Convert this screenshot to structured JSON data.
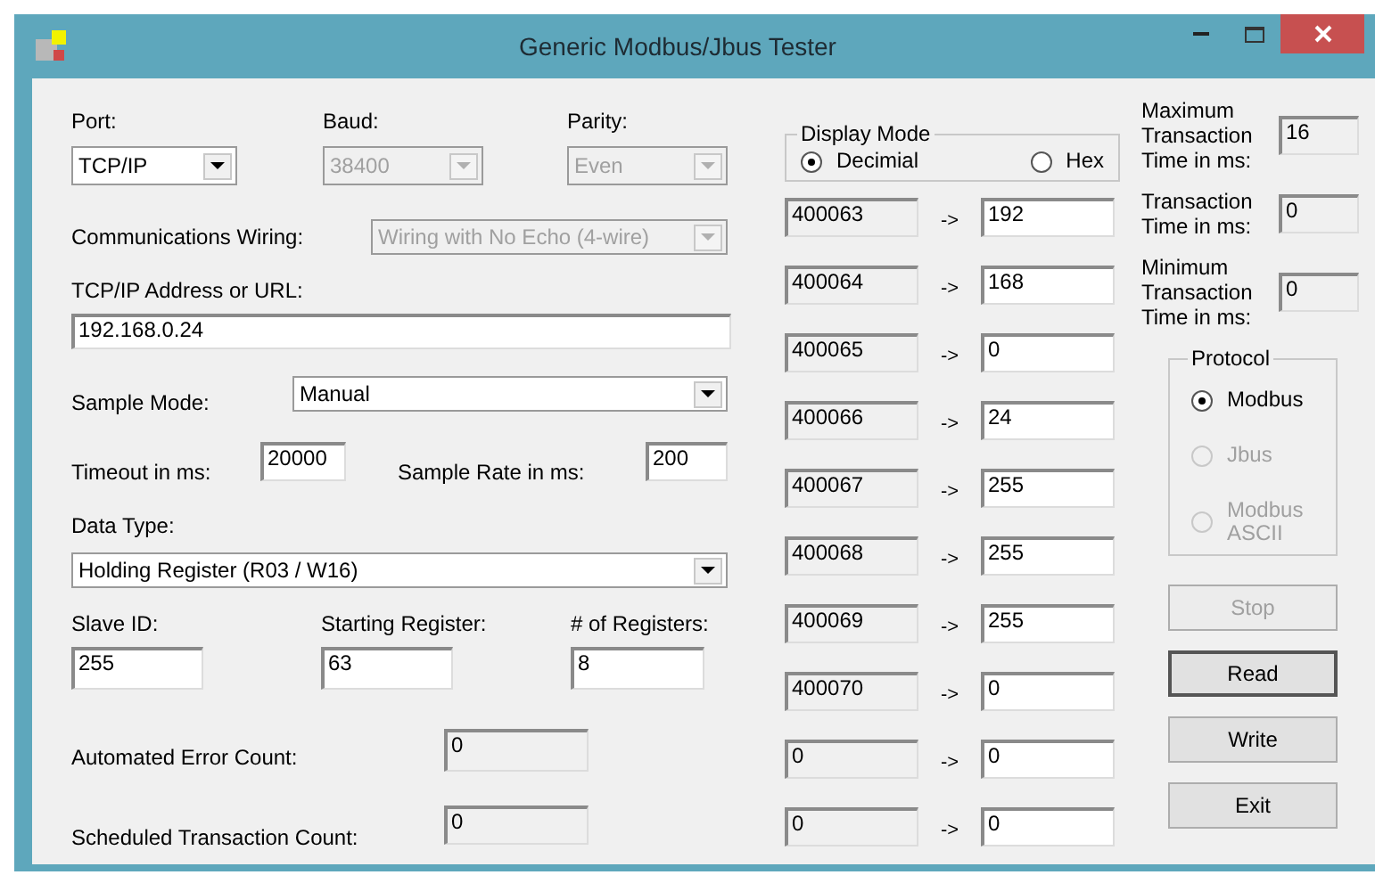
{
  "window": {
    "title": "Generic Modbus/Jbus Tester"
  },
  "port": {
    "label": "Port:",
    "value": "TCP/IP",
    "disabled": false
  },
  "baud": {
    "label": "Baud:",
    "value": "38400",
    "disabled": true
  },
  "parity": {
    "label": "Parity:",
    "value": "Even",
    "disabled": true
  },
  "wiring": {
    "label": "Communications Wiring:",
    "value": "Wiring with No Echo (4-wire)",
    "disabled": true
  },
  "address": {
    "label": "TCP/IP Address or URL:",
    "value": "192.168.0.24"
  },
  "sample_mode": {
    "label": "Sample Mode:",
    "value": "Manual",
    "disabled": false
  },
  "timeout": {
    "label": "Timeout in ms:",
    "value": "20000"
  },
  "sample_rate": {
    "label": "Sample Rate in ms:",
    "value": "200"
  },
  "data_type": {
    "label": "Data Type:",
    "value": "Holding Register (R03 / W16)",
    "disabled": false
  },
  "slave_id": {
    "label": "Slave ID:",
    "value": "255"
  },
  "starting_register": {
    "label": "Starting Register:",
    "value": "63"
  },
  "register_count": {
    "label": "# of Registers:",
    "value": "8"
  },
  "error_count": {
    "label": "Automated Error Count:",
    "value": "0"
  },
  "transaction_count": {
    "label": "Scheduled Transaction Count:",
    "value": "0"
  },
  "display_mode": {
    "label": "Display Mode",
    "options": [
      {
        "label": "Decimial",
        "selected": true
      },
      {
        "label": "Hex",
        "selected": false
      }
    ]
  },
  "registers": [
    {
      "address": "400063",
      "arrow": "->",
      "value": "192"
    },
    {
      "address": "400064",
      "arrow": "->",
      "value": "168"
    },
    {
      "address": "400065",
      "arrow": "->",
      "value": "0"
    },
    {
      "address": "400066",
      "arrow": "->",
      "value": "24"
    },
    {
      "address": "400067",
      "arrow": "->",
      "value": "255"
    },
    {
      "address": "400068",
      "arrow": "->",
      "value": "255"
    },
    {
      "address": "400069",
      "arrow": "->",
      "value": "255"
    },
    {
      "address": "400070",
      "arrow": "->",
      "value": "0"
    },
    {
      "address": "0",
      "arrow": "->",
      "value": "0"
    },
    {
      "address": "0",
      "arrow": "->",
      "value": "0"
    }
  ],
  "timing": [
    {
      "label": "Maximum Transaction Time in ms:",
      "value": "16"
    },
    {
      "label": "Transaction Time in ms:",
      "value": "0"
    },
    {
      "label": "Minimum Transaction Time in ms:",
      "value": "0"
    }
  ],
  "protocol": {
    "label": "Protocol",
    "options": [
      {
        "label": "Modbus",
        "selected": true,
        "disabled": false
      },
      {
        "label": "Jbus",
        "selected": false,
        "disabled": true
      },
      {
        "label": "Modbus ASCII",
        "selected": false,
        "disabled": true
      }
    ]
  },
  "buttons": [
    {
      "label": "Stop",
      "disabled": true,
      "focused": false
    },
    {
      "label": "Read",
      "disabled": false,
      "focused": true
    },
    {
      "label": "Write",
      "disabled": false,
      "focused": false
    },
    {
      "label": "Exit",
      "disabled": false,
      "focused": false
    }
  ]
}
